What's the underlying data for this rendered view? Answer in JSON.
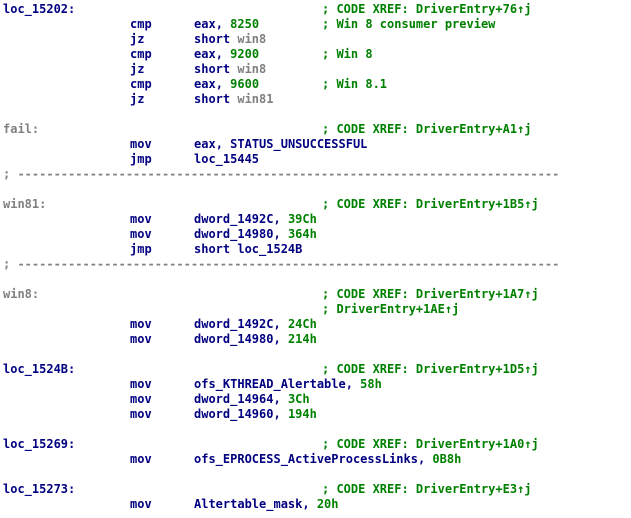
{
  "colors": {
    "background": "#ffffff",
    "mnemonic": "#000080",
    "comment": "#008000",
    "number": "#008000",
    "label_grey": "#808080",
    "separator": "#808080"
  },
  "separator_text": "; ---------------------------------------------------------------------------",
  "lines": [
    {
      "kind": "label",
      "name": "loc_15202:",
      "style": "norm",
      "comment": "; CODE XREF: DriverEntry+76↑j"
    },
    {
      "kind": "insn",
      "mnemonic": "cmp",
      "ops": [
        {
          "t": "reg",
          "v": "eax"
        },
        {
          "t": "sep",
          "v": ", "
        },
        {
          "t": "num",
          "v": "8250"
        }
      ],
      "comment": "; Win 8 consumer preview"
    },
    {
      "kind": "insn",
      "mnemonic": "jz",
      "ops": [
        {
          "t": "reg",
          "v": "short "
        },
        {
          "t": "lab",
          "v": "win8"
        }
      ]
    },
    {
      "kind": "insn",
      "mnemonic": "cmp",
      "ops": [
        {
          "t": "reg",
          "v": "eax"
        },
        {
          "t": "sep",
          "v": ", "
        },
        {
          "t": "num",
          "v": "9200"
        }
      ],
      "comment": "; Win 8"
    },
    {
      "kind": "insn",
      "mnemonic": "jz",
      "ops": [
        {
          "t": "reg",
          "v": "short "
        },
        {
          "t": "lab",
          "v": "win8"
        }
      ]
    },
    {
      "kind": "insn",
      "mnemonic": "cmp",
      "ops": [
        {
          "t": "reg",
          "v": "eax"
        },
        {
          "t": "sep",
          "v": ", "
        },
        {
          "t": "num",
          "v": "9600"
        }
      ],
      "comment": "; Win 8.1"
    },
    {
      "kind": "insn",
      "mnemonic": "jz",
      "ops": [
        {
          "t": "reg",
          "v": "short "
        },
        {
          "t": "lab",
          "v": "win81"
        }
      ]
    },
    {
      "kind": "blank"
    },
    {
      "kind": "label",
      "name": "fail:",
      "style": "grey",
      "comment": "; CODE XREF: DriverEntry+A1↑j"
    },
    {
      "kind": "insn",
      "mnemonic": "mov",
      "ops": [
        {
          "t": "reg",
          "v": "eax"
        },
        {
          "t": "sep",
          "v": ", "
        },
        {
          "t": "name",
          "v": "STATUS_UNSUCCESSFUL"
        }
      ]
    },
    {
      "kind": "insn",
      "mnemonic": "jmp",
      "ops": [
        {
          "t": "name",
          "v": "loc_15445"
        }
      ]
    },
    {
      "kind": "separator"
    },
    {
      "kind": "blank"
    },
    {
      "kind": "label",
      "name": "win81:",
      "style": "grey",
      "comment": "; CODE XREF: DriverEntry+1B5↑j"
    },
    {
      "kind": "insn",
      "mnemonic": "mov",
      "ops": [
        {
          "t": "name",
          "v": "dword_1492C"
        },
        {
          "t": "sep",
          "v": ", "
        },
        {
          "t": "num",
          "v": "39Ch"
        }
      ]
    },
    {
      "kind": "insn",
      "mnemonic": "mov",
      "ops": [
        {
          "t": "name",
          "v": "dword_14980"
        },
        {
          "t": "sep",
          "v": ", "
        },
        {
          "t": "num",
          "v": "364h"
        }
      ]
    },
    {
      "kind": "insn",
      "mnemonic": "jmp",
      "ops": [
        {
          "t": "reg",
          "v": "short "
        },
        {
          "t": "name",
          "v": "loc_1524B"
        }
      ]
    },
    {
      "kind": "separator"
    },
    {
      "kind": "blank"
    },
    {
      "kind": "label",
      "name": "win8:",
      "style": "grey",
      "comment": "; CODE XREF: DriverEntry+1A7↑j"
    },
    {
      "kind": "cont",
      "comment": "; DriverEntry+1AE↑j"
    },
    {
      "kind": "insn",
      "mnemonic": "mov",
      "ops": [
        {
          "t": "name",
          "v": "dword_1492C"
        },
        {
          "t": "sep",
          "v": ", "
        },
        {
          "t": "num",
          "v": "24Ch"
        }
      ]
    },
    {
      "kind": "insn",
      "mnemonic": "mov",
      "ops": [
        {
          "t": "name",
          "v": "dword_14980"
        },
        {
          "t": "sep",
          "v": ", "
        },
        {
          "t": "num",
          "v": "214h"
        }
      ]
    },
    {
      "kind": "blank"
    },
    {
      "kind": "label",
      "name": "loc_1524B:",
      "style": "norm",
      "comment": "; CODE XREF: DriverEntry+1D5↑j"
    },
    {
      "kind": "insn",
      "mnemonic": "mov",
      "ops": [
        {
          "t": "name",
          "v": "ofs_KTHREAD_Alertable"
        },
        {
          "t": "sep",
          "v": ", "
        },
        {
          "t": "num",
          "v": "58h"
        }
      ]
    },
    {
      "kind": "insn",
      "mnemonic": "mov",
      "ops": [
        {
          "t": "name",
          "v": "dword_14964"
        },
        {
          "t": "sep",
          "v": ", "
        },
        {
          "t": "num",
          "v": "3Ch"
        }
      ]
    },
    {
      "kind": "insn",
      "mnemonic": "mov",
      "ops": [
        {
          "t": "name",
          "v": "dword_14960"
        },
        {
          "t": "sep",
          "v": ", "
        },
        {
          "t": "num",
          "v": "194h"
        }
      ]
    },
    {
      "kind": "blank"
    },
    {
      "kind": "label",
      "name": "loc_15269:",
      "style": "norm",
      "comment": "; CODE XREF: DriverEntry+1A0↑j"
    },
    {
      "kind": "insn",
      "mnemonic": "mov",
      "ops": [
        {
          "t": "name",
          "v": "ofs_EPROCESS_ActiveProcessLinks"
        },
        {
          "t": "sep",
          "v": ", "
        },
        {
          "t": "num",
          "v": "0B8h"
        }
      ]
    },
    {
      "kind": "blank"
    },
    {
      "kind": "label",
      "name": "loc_15273:",
      "style": "norm",
      "comment": "; CODE XREF: DriverEntry+E3↑j"
    },
    {
      "kind": "insn",
      "mnemonic": "mov",
      "ops": [
        {
          "t": "name",
          "v": "Altertable_mask"
        },
        {
          "t": "sep",
          "v": ", "
        },
        {
          "t": "num",
          "v": "20h"
        }
      ]
    }
  ]
}
